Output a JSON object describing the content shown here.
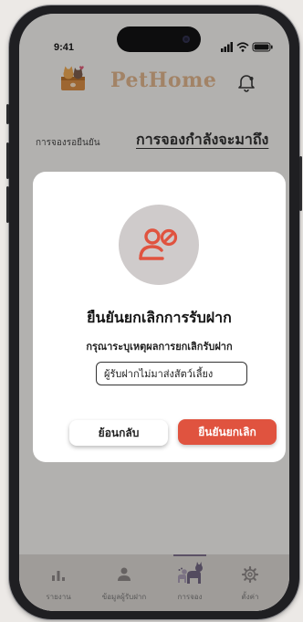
{
  "status_bar": {
    "time": "9:41"
  },
  "app": {
    "brand": "PetHome"
  },
  "booking_tabs": {
    "pending_label": "การจองรอยืนยัน",
    "upcoming_label": "การจองกำลังจะมาถึง"
  },
  "modal": {
    "title": "ยืนยันยกเลิกการรับฝาก",
    "subtitle": "กรุณาระบุเหตุผลการยกเลิกรับฝาก",
    "reason_value": "ผู้รับฝากไม่มาส่งสัตว์เลี้ยง",
    "back_label": "ย้อนกลับ",
    "confirm_label": "ยืนยันยกเลิก",
    "icon": "user-blocked-icon"
  },
  "bottom_nav": {
    "items": [
      {
        "label": "รายงาน",
        "icon": "bar-chart-icon"
      },
      {
        "label": "ข้อมูลผู้รับฝาก",
        "icon": "person-icon"
      },
      {
        "label": "การจอง",
        "icon": "pets-icon"
      },
      {
        "label": "ตั้งค่า",
        "icon": "gear-icon"
      }
    ],
    "active_index": 2
  },
  "colors": {
    "brand": "#e0b38a",
    "danger": "#e0533f",
    "overlay": "rgba(20,20,20,0.30)",
    "nav_bg": "#dcd7d3"
  }
}
